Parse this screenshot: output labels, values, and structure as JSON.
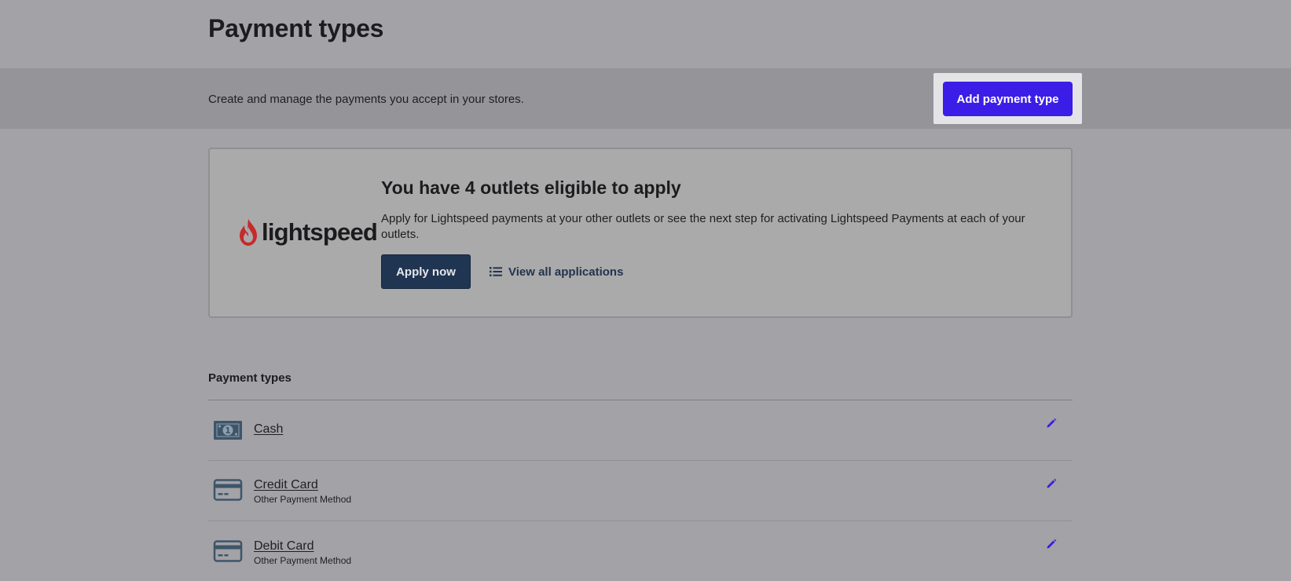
{
  "header": {
    "title": "Payment types"
  },
  "subbar": {
    "description": "Create and manage the payments you accept in your stores.",
    "add_button_label": "Add payment type"
  },
  "promo": {
    "logo_text": "lightspeed",
    "title": "You have 4 outlets eligible to apply",
    "description": "Apply for Lightspeed payments at your other outlets or see the next step for activating Lightspeed Payments at each of your outlets.",
    "apply_button_label": "Apply now",
    "view_link_label": "View all applications"
  },
  "list": {
    "title": "Payment types",
    "rows": [
      {
        "name": "Cash",
        "subtitle": "",
        "icon": "cash-icon"
      },
      {
        "name": "Credit Card",
        "subtitle": "Other Payment Method",
        "icon": "credit-card-icon"
      },
      {
        "name": "Debit Card",
        "subtitle": "Other Payment Method",
        "icon": "credit-card-icon"
      }
    ]
  },
  "colors": {
    "accent": "#3a1ee8",
    "navy": "#1f3552",
    "logo_red": "#c62a2a",
    "icon_slate": "#3e5569"
  }
}
